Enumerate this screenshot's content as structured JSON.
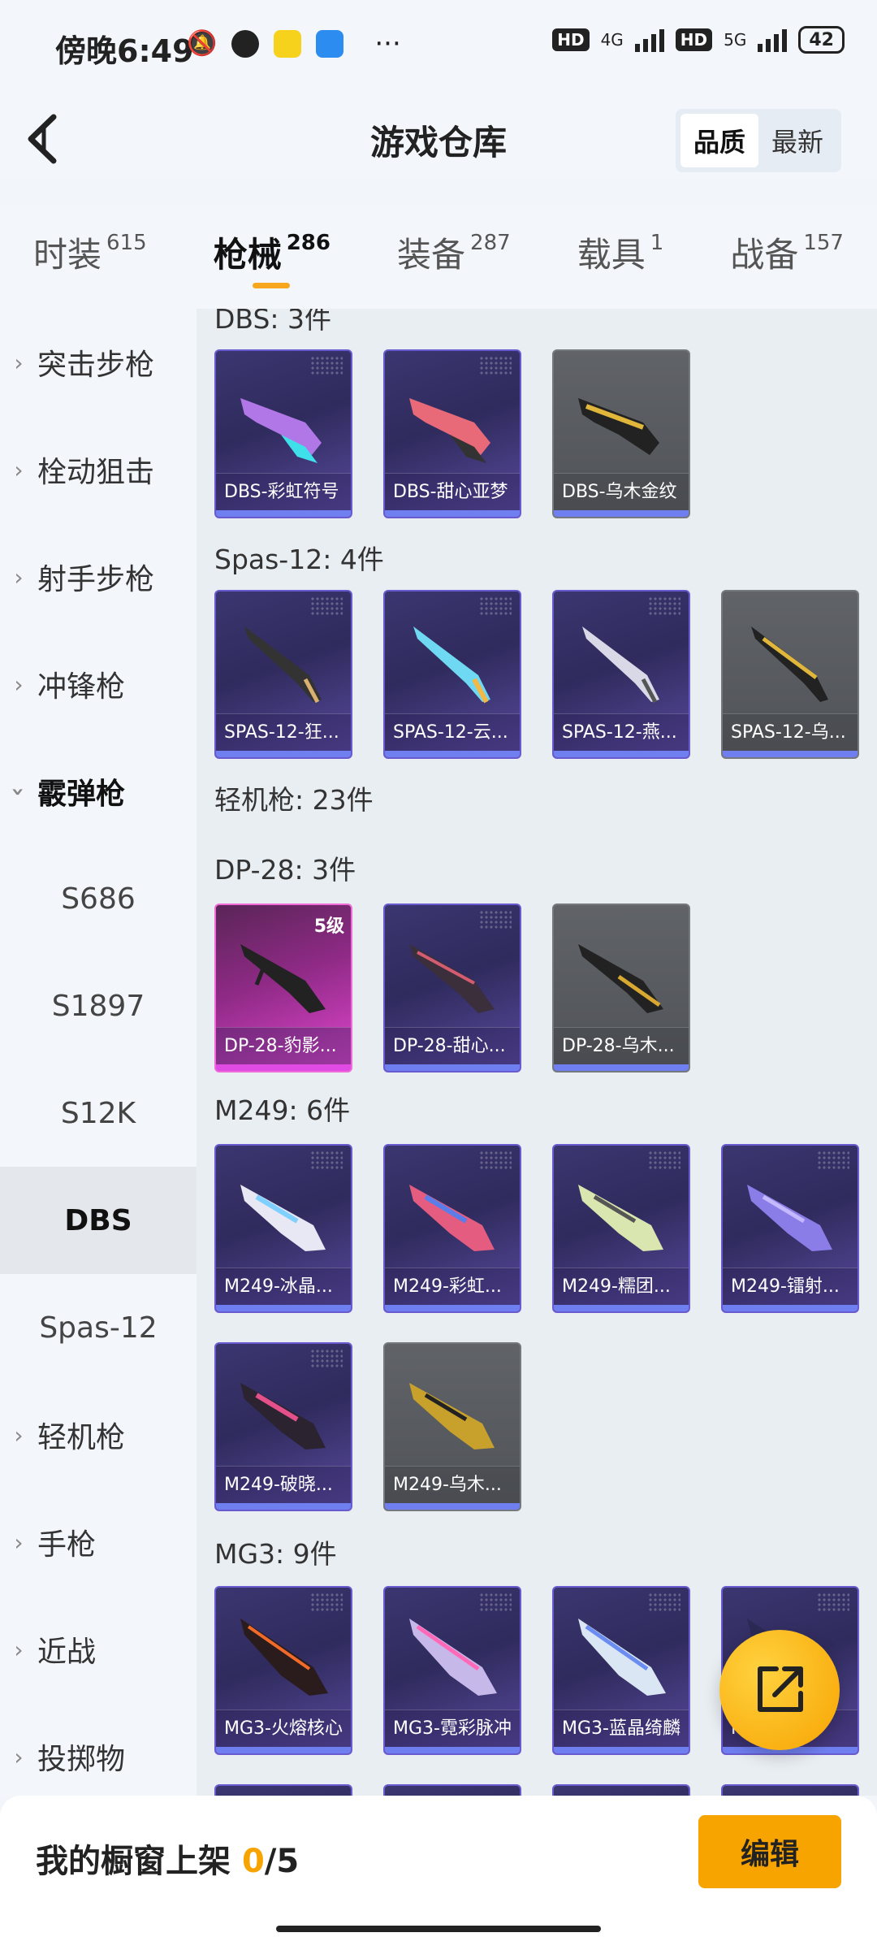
{
  "status_bar": {
    "time": "傍晚6:49",
    "net1": "4G",
    "net2": "5G",
    "battery": "42",
    "more": "···"
  },
  "header": {
    "title": "游戏仓库",
    "sort_options": [
      "品质",
      "最新"
    ],
    "sort_active": "品质"
  },
  "tabs": [
    {
      "label": "时装",
      "count": "615"
    },
    {
      "label": "枪械",
      "count": "286",
      "active": true
    },
    {
      "label": "装备",
      "count": "287"
    },
    {
      "label": "载具",
      "count": "1"
    },
    {
      "label": "战备",
      "count": "157"
    }
  ],
  "sidebar": [
    {
      "label": "突击步枪",
      "type": "category"
    },
    {
      "label": "栓动狙击",
      "type": "category"
    },
    {
      "label": "射手步枪",
      "type": "category"
    },
    {
      "label": "冲锋枪",
      "type": "category"
    },
    {
      "label": "霰弹枪",
      "type": "category-open"
    },
    {
      "label": "S686",
      "type": "sub"
    },
    {
      "label": "S1897",
      "type": "sub"
    },
    {
      "label": "S12K",
      "type": "sub"
    },
    {
      "label": "DBS",
      "type": "sub-selected"
    },
    {
      "label": "Spas-12",
      "type": "sub"
    },
    {
      "label": "轻机枪",
      "type": "category"
    },
    {
      "label": "手枪",
      "type": "category"
    },
    {
      "label": "近战",
      "type": "category"
    },
    {
      "label": "投掷物",
      "type": "category"
    }
  ],
  "groups": {
    "dbs": "DBS: 3件",
    "spas": "Spas-12: 4件",
    "lmg": "轻机枪: 23件",
    "dp28": "DP-28: 3件",
    "m249": "M249: 6件",
    "mg3": "MG3: 9件"
  },
  "cards": {
    "dbs": [
      "DBS-彩虹符号",
      "DBS-甜心亚梦",
      "DBS-乌木金纹"
    ],
    "spas": [
      "SPAS-12-狂...",
      "SPAS-12-云...",
      "SPAS-12-燕...",
      "SPAS-12-乌..."
    ],
    "dp28": [
      "DP-28-豹影...",
      "DP-28-甜心...",
      "DP-28-乌木..."
    ],
    "dp28_level": "5级",
    "m249": [
      "M249-冰晶...",
      "M249-彩虹...",
      "M249-糯团...",
      "M249-镭射...",
      "M249-破晓...",
      "M249-乌木..."
    ],
    "mg3": [
      "MG3-火熔核心",
      "MG3-霓彩脉冲",
      "MG3-蓝晶绮麟",
      "M...战..."
    ]
  },
  "bottom_bar": {
    "label": "我的橱窗上架",
    "current": "0",
    "total": "/5",
    "edit": "编辑"
  },
  "colors": {
    "accent": "#f7a300",
    "card_purple": "#3b3670",
    "card_gold": "#606368",
    "card_pink": "#8f2a86"
  }
}
